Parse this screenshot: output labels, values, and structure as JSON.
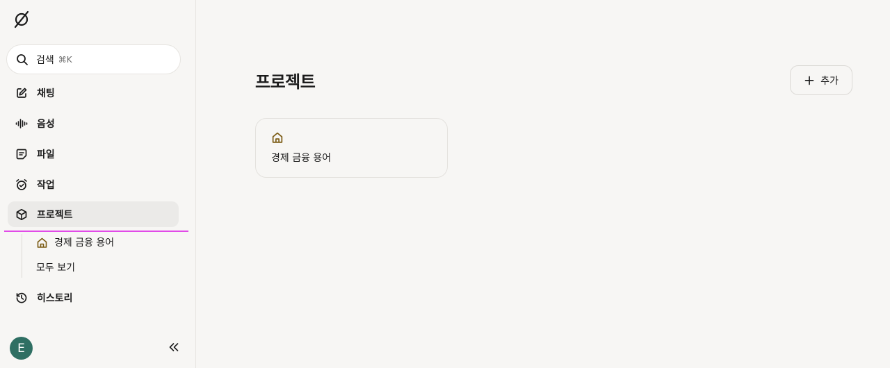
{
  "sidebar": {
    "search": {
      "label": "검색",
      "shortcut": "⌘K"
    },
    "nav": [
      {
        "label": "채팅",
        "icon": "edit-icon"
      },
      {
        "label": "음성",
        "icon": "waveform-icon"
      },
      {
        "label": "파일",
        "icon": "file-icon"
      },
      {
        "label": "작업",
        "icon": "alarm-icon"
      },
      {
        "label": "프로젝트",
        "icon": "box-icon",
        "active": true
      },
      {
        "label": "히스토리",
        "icon": "history-icon"
      }
    ],
    "subitems": [
      {
        "label": "경제 금융 용어",
        "icon": "home-icon"
      },
      {
        "label": "모두 보기"
      }
    ],
    "avatar": {
      "initial": "E",
      "color": "#2f6f63"
    },
    "collapse_icon": "double-chevron-left-icon"
  },
  "main": {
    "title": "프로젝트",
    "add_button": {
      "label": "추가",
      "icon": "plus-icon"
    },
    "projects": [
      {
        "name": "경제 금융 용어",
        "icon": "home-icon",
        "icon_color": "#7a5a12"
      }
    ]
  },
  "colors": {
    "background": "#f7f6f4",
    "active_item": "#ebeae8",
    "highlight_line": "#e14be8"
  }
}
